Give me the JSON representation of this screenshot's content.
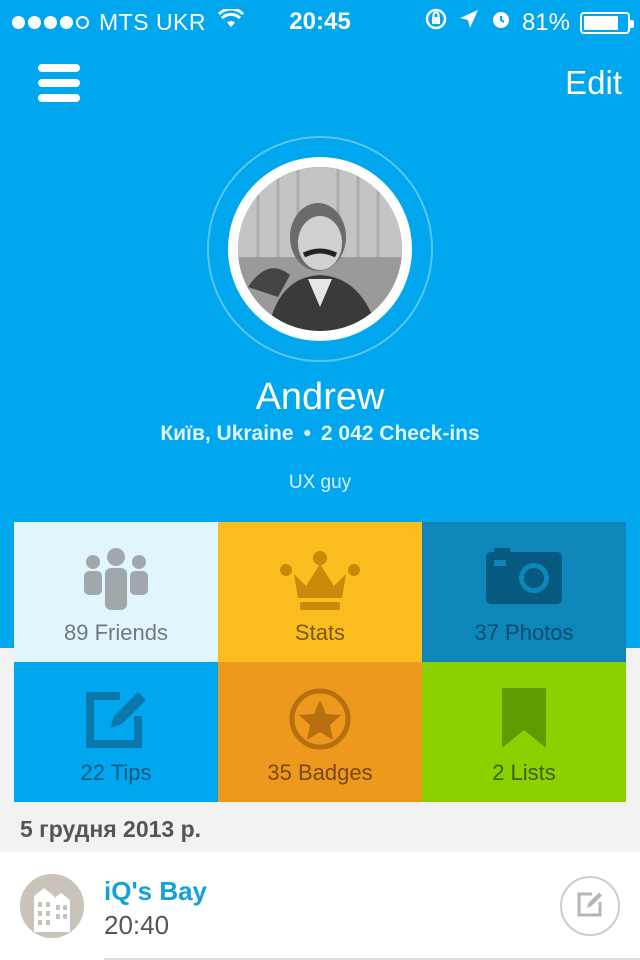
{
  "status_bar": {
    "carrier": "MTS UKR",
    "time": "20:45",
    "battery": "81%",
    "battery_level": 0.81,
    "signal_bars_filled": 4,
    "signal_bars_total": 5
  },
  "nav": {
    "edit_label": "Edit",
    "menu_icon": "hamburger-icon"
  },
  "profile": {
    "name": "Andrew",
    "location": "Київ, Ukraine",
    "separator": "•",
    "checkins": "2 042 Check-ins",
    "bio": "UX guy"
  },
  "tiles": [
    {
      "label": "89 Friends",
      "icon": "friends-icon",
      "bg": "#e1f5fd",
      "color": "#6e7a80",
      "icon_color": "#a0a8ac"
    },
    {
      "label": "Stats",
      "icon": "crown-icon",
      "bg": "#fbbc1e",
      "color": "#7a5a0c",
      "icon_color": "#c98a0a"
    },
    {
      "label": "37 Photos",
      "icon": "camera-icon",
      "bg": "#0e86ba",
      "color": "#0b4e6e",
      "icon_color": "#075a7f"
    },
    {
      "label": "22 Tips",
      "icon": "edit-icon",
      "bg": "#00a6ee",
      "color": "#0b5a82",
      "icon_color": "#0a78ad"
    },
    {
      "label": "35 Badges",
      "icon": "star-badge-icon",
      "bg": "#ec991d",
      "color": "#7a4a0a",
      "icon_color": "#b8700f"
    },
    {
      "label": "2 Lists",
      "icon": "bookmark-icon",
      "bg": "#8bd100",
      "color": "#3c6100",
      "icon_color": "#5e9a00"
    }
  ],
  "feed": {
    "date_header": "5 грудня 2013 р.",
    "items": [
      {
        "venue": "iQ's Bay",
        "time": "20:40"
      }
    ]
  },
  "colors": {
    "header_bg": "#00a6ee",
    "link": "#13a1dc"
  }
}
